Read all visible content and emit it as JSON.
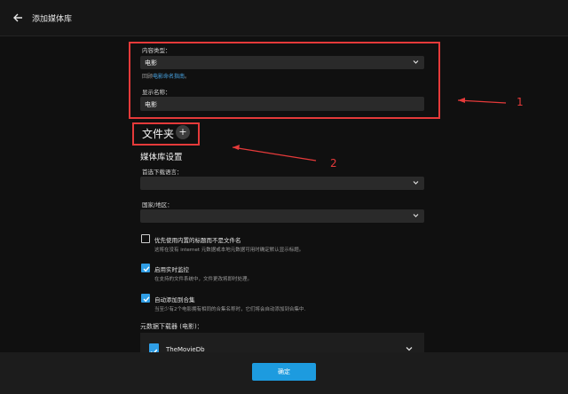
{
  "header": {
    "title": "添加媒体库",
    "back_icon": "arrow-left-icon"
  },
  "content_type": {
    "label": "内容类型：",
    "value": "电影"
  },
  "hint": {
    "prefix": "回顾",
    "link": "电影命名指南",
    "suffix": "。"
  },
  "display_name": {
    "label": "显示名称：",
    "value": "电影"
  },
  "folders": {
    "heading": "文件夹",
    "add_label": "+"
  },
  "library_settings": {
    "heading": "媒体库设置",
    "language": {
      "label": "首选下载语言：",
      "value": ""
    },
    "country": {
      "label": "国家/地区：",
      "value": ""
    }
  },
  "options": [
    {
      "label": "优先使用内置的标题而不是文件名",
      "description": "这将在没有 internet 元数据或本地元数据可用时确定默认显示标题。",
      "checked": false
    },
    {
      "label": "启用实时监控",
      "description": "在支持的文件系统中，文件更改将即时处理。",
      "checked": true
    },
    {
      "label": "自动添加到合集",
      "description": "当至少有2个电影拥有相同的合集名称时，它们将会自动添加到合集中.",
      "checked": true
    }
  ],
  "downloaders": {
    "heading": "元数据下载器 (电影)：",
    "items": [
      {
        "name": "TheMovieDb",
        "checked": true
      }
    ]
  },
  "footer": {
    "ok_label": "确定"
  },
  "annotations": {
    "marker1": "1",
    "marker2": "2",
    "color": "#e53a3a"
  },
  "colors": {
    "accent": "#1d9bdf",
    "background": "#101010",
    "field": "#2a2a2a"
  }
}
